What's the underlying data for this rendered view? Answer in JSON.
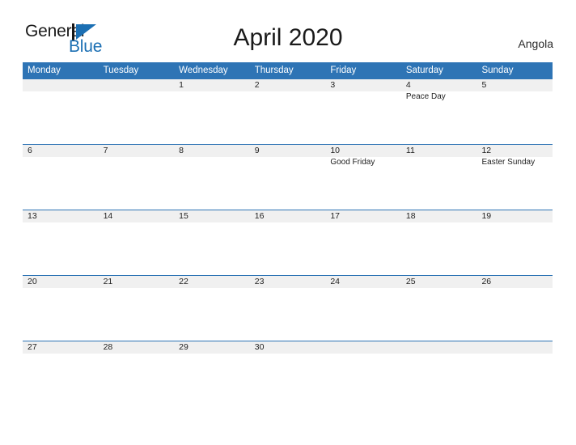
{
  "brand": {
    "name_line1": "General",
    "name_line2": "Blue",
    "flag_icon": "blue-triangle-flag-icon",
    "primary_color": "#2e74b5",
    "text_color": "#1a1a1a"
  },
  "header": {
    "title": "April 2020",
    "country": "Angola"
  },
  "calendar": {
    "month": "April",
    "year": "2020",
    "week_start": "Monday",
    "header_background": "#2e74b5",
    "date_band_background": "#f0f0f0",
    "row_border_color": "#2e74b5",
    "day_names": [
      "Monday",
      "Tuesday",
      "Wednesday",
      "Thursday",
      "Friday",
      "Saturday",
      "Sunday"
    ],
    "weeks": [
      [
        {
          "date": "",
          "event": ""
        },
        {
          "date": "",
          "event": ""
        },
        {
          "date": "1",
          "event": ""
        },
        {
          "date": "2",
          "event": ""
        },
        {
          "date": "3",
          "event": ""
        },
        {
          "date": "4",
          "event": "Peace Day"
        },
        {
          "date": "5",
          "event": ""
        }
      ],
      [
        {
          "date": "6",
          "event": ""
        },
        {
          "date": "7",
          "event": ""
        },
        {
          "date": "8",
          "event": ""
        },
        {
          "date": "9",
          "event": ""
        },
        {
          "date": "10",
          "event": "Good Friday"
        },
        {
          "date": "11",
          "event": ""
        },
        {
          "date": "12",
          "event": "Easter Sunday"
        }
      ],
      [
        {
          "date": "13",
          "event": ""
        },
        {
          "date": "14",
          "event": ""
        },
        {
          "date": "15",
          "event": ""
        },
        {
          "date": "16",
          "event": ""
        },
        {
          "date": "17",
          "event": ""
        },
        {
          "date": "18",
          "event": ""
        },
        {
          "date": "19",
          "event": ""
        }
      ],
      [
        {
          "date": "20",
          "event": ""
        },
        {
          "date": "21",
          "event": ""
        },
        {
          "date": "22",
          "event": ""
        },
        {
          "date": "23",
          "event": ""
        },
        {
          "date": "24",
          "event": ""
        },
        {
          "date": "25",
          "event": ""
        },
        {
          "date": "26",
          "event": ""
        }
      ],
      [
        {
          "date": "27",
          "event": ""
        },
        {
          "date": "28",
          "event": ""
        },
        {
          "date": "29",
          "event": ""
        },
        {
          "date": "30",
          "event": ""
        },
        {
          "date": "",
          "event": ""
        },
        {
          "date": "",
          "event": ""
        },
        {
          "date": "",
          "event": ""
        }
      ]
    ]
  }
}
